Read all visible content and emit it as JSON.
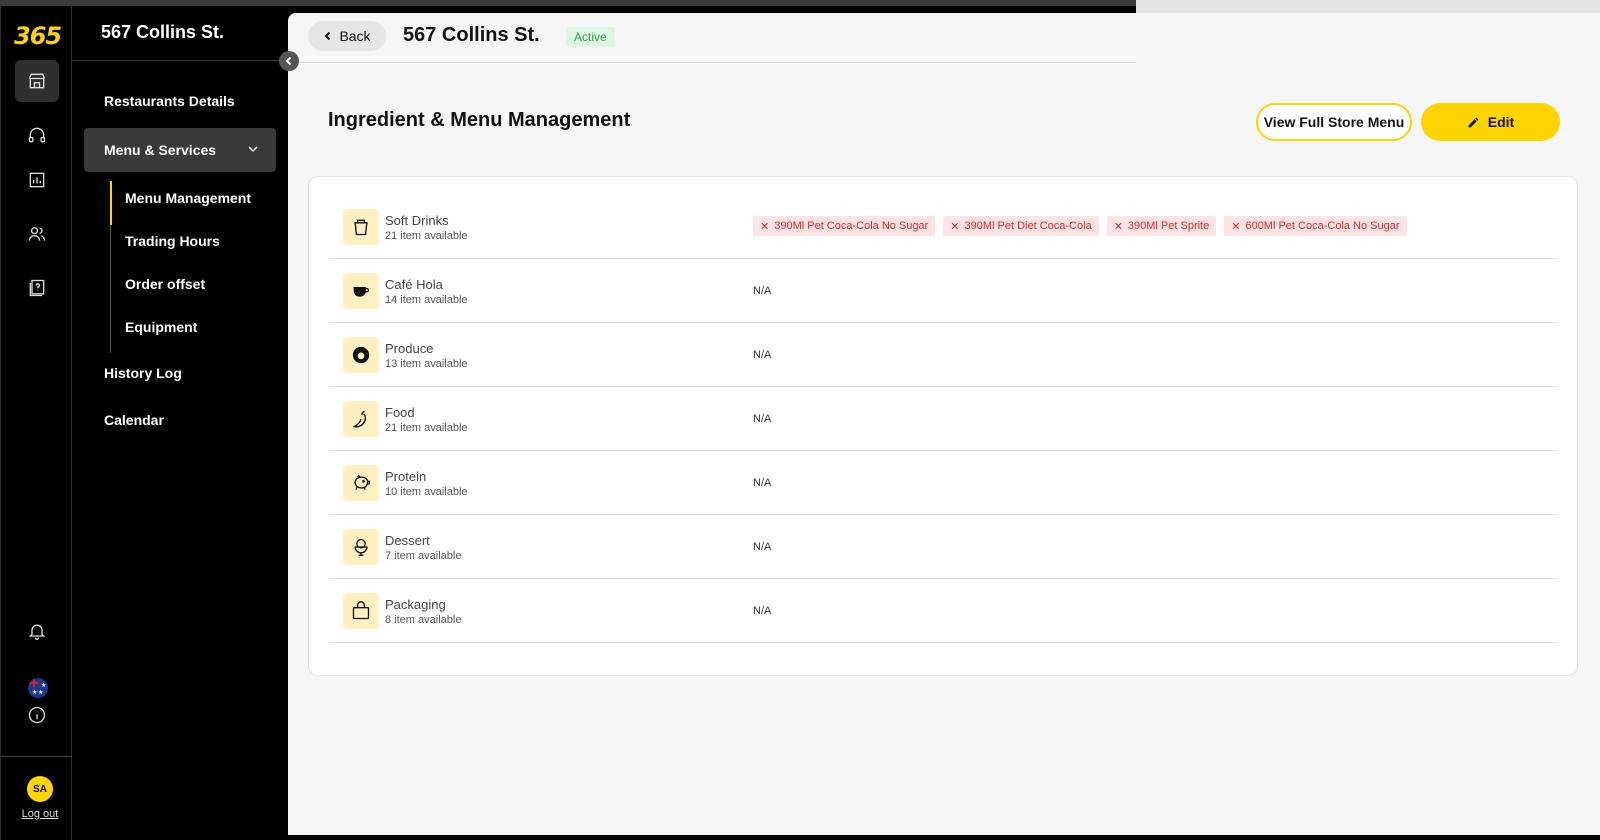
{
  "app": {
    "logo": "365"
  },
  "rail": {
    "avatar_initials": "SA",
    "logout_label": "Log out"
  },
  "sidebar": {
    "store_name": "567 Collins St.",
    "items": [
      {
        "label": "Restaurants Details"
      },
      {
        "label": "Menu & Services"
      },
      {
        "label": "History Log"
      },
      {
        "label": "Calendar"
      }
    ],
    "subitems": [
      {
        "label": "Menu Management"
      },
      {
        "label": "Trading Hours"
      },
      {
        "label": "Order offset"
      },
      {
        "label": "Equipment"
      }
    ]
  },
  "header": {
    "back_label": "Back",
    "title": "567 Collins St.",
    "status": "Active"
  },
  "page": {
    "title": "Ingredient & Menu Management",
    "view_menu_label": "View Full Store Menu",
    "edit_label": "Edit"
  },
  "categories": [
    {
      "name": "Soft Drinks",
      "count": "21 item available",
      "icon": "cup-icon",
      "tags": [
        "390Ml Pet Coca-Cola No Sugar",
        "390Ml Pet Diet Coca-Cola",
        "390Ml Pet Sprite",
        "600Ml Pet Coca-Cola No Sugar"
      ]
    },
    {
      "name": "Café Hola",
      "count": "14 item available",
      "icon": "coffee-icon",
      "value": "N/A"
    },
    {
      "name": "Produce",
      "count": "13 item available",
      "icon": "egg-icon",
      "value": "N/A"
    },
    {
      "name": "Food",
      "count": "21 item available",
      "icon": "chili-icon",
      "value": "N/A"
    },
    {
      "name": "Protein",
      "count": "10 item available",
      "icon": "pig-icon",
      "value": "N/A"
    },
    {
      "name": "Dessert",
      "count": "7 item available",
      "icon": "ice-cream-icon",
      "value": "N/A"
    },
    {
      "name": "Packaging",
      "count": "8 item available",
      "icon": "bag-icon",
      "value": "N/A"
    }
  ],
  "colors": {
    "accent": "#ffd400",
    "active_badge_bg": "#dff4e3",
    "active_badge_text": "#2ea24a",
    "tag_bg": "#fde3e3",
    "tag_text": "#d42a2a"
  }
}
